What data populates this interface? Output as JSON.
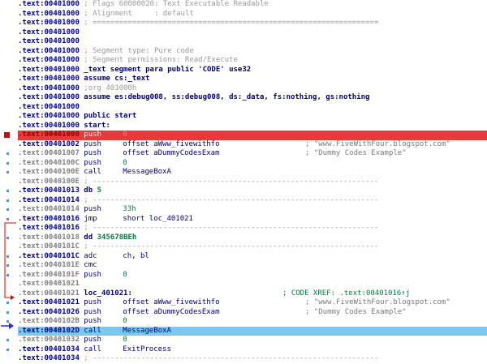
{
  "listing": {
    "lines": [
      {
        "addr": ".text:00401000",
        "text": " ; Flags 60000020: Text Executable Readable"
      },
      {
        "addr": ".text:00401000",
        "text": " ; Alignment     : default"
      },
      {
        "addr": ".text:00401000",
        "text": " ; ================================================================="
      },
      {
        "addr": ".text:00401000",
        "text": ""
      },
      {
        "addr": ".text:00401000",
        "text": ""
      },
      {
        "addr": ".text:00401000",
        "text": " ; Segment type: Pure code"
      },
      {
        "addr": ".text:00401000",
        "text": " ; Segment permissions: Read/Execute"
      },
      {
        "addr": ".text:00401000",
        "text": " _text segment para public 'CODE' use32"
      },
      {
        "addr": ".text:00401000",
        "text": " assume cs:_text"
      },
      {
        "addr": ".text:00401000",
        "text": " ;org 401000h"
      },
      {
        "addr": ".text:00401000",
        "text": " assume es:debug008, ss:debug008, ds:_data, fs:nothing, gs:nothing"
      },
      {
        "addr": ".text:00401000",
        "text": ""
      },
      {
        "addr": ".text:00401000",
        "text": " public start"
      },
      {
        "addr": ".text:00401000",
        "text": " start:"
      },
      {
        "addr": ".text:00401000",
        "mnemonic": "push",
        "operand": "0"
      },
      {
        "addr": ".text:00401002",
        "mnemonic": "push",
        "operand": "offset aWww_fivewithfo",
        "comment": "; \"www.FiveWithFour.blogspot.com\""
      },
      {
        "addr": ".text:00401007",
        "mnemonic": "push",
        "operand": "offset aDummyCodesExam",
        "comment": "; \"Dummy Codes Example\""
      },
      {
        "addr": ".text:0040100C",
        "mnemonic": "push",
        "operand": "0"
      },
      {
        "addr": ".text:0040100E",
        "mnemonic": "call",
        "operand": "MessageBoxA"
      },
      {
        "addr": ".text:0040100E",
        "text": " ; -----------------------------------------------------------------"
      },
      {
        "addr": ".text:00401013",
        "text": " db 5"
      },
      {
        "addr": ".text:00401014",
        "text": " ; -----------------------------------------------------------------"
      },
      {
        "addr": ".text:00401014",
        "mnemonic": "push",
        "operand": "33h"
      },
      {
        "addr": ".text:00401016",
        "mnemonic": "jmp",
        "operand": "short loc_401021"
      },
      {
        "addr": ".text:00401016",
        "text": " ; -----------------------------------------------------------------"
      },
      {
        "addr": ".text:00401018",
        "text": " dd 345678BEh"
      },
      {
        "addr": ".text:0040101C",
        "text": " ; -----------------------------------------------------------------"
      },
      {
        "addr": ".text:0040101C",
        "mnemonic": "adc",
        "operand": "ch, bl"
      },
      {
        "addr": ".text:0040101E",
        "mnemonic": "cmc",
        "operand": ""
      },
      {
        "addr": ".text:0040101F",
        "mnemonic": "push",
        "operand": "0"
      },
      {
        "addr": ".text:00401021",
        "text": ""
      },
      {
        "addr": ".text:00401021",
        "text": " loc_401021:",
        "comment": "; CODE XREF: .text:00401016↑j"
      },
      {
        "addr": ".text:00401021",
        "mnemonic": "push",
        "operand": "offset aWww_fivewithfo",
        "comment": "; \"www.FiveWithFour.blogspot.com\""
      },
      {
        "addr": ".text:00401026",
        "mnemonic": "push",
        "operand": "offset aDummyCodesExam",
        "comment": "; \"Dummy Codes Example\""
      },
      {
        "addr": ".text:0040102B",
        "mnemonic": "push",
        "operand": "0"
      },
      {
        "addr": ".text:0040102D",
        "mnemonic": "call",
        "operand": "MessageBoxA"
      },
      {
        "addr": ".text:00401032",
        "mnemonic": "push",
        "operand": "0"
      },
      {
        "addr": ".text:00401034",
        "mnemonic": "call",
        "operand": "ExitProcess"
      },
      {
        "addr": ".text:00401034",
        "text": " ; -----------------------------------------------------------------"
      }
    ]
  },
  "colors": {
    "breakpoint_line": "#e83a3a",
    "current_line": "#78c8f0",
    "address": "#0000a0",
    "number": "#008040",
    "gutter_arrow": "#e00000",
    "current_arrow": "#2a2ad0"
  }
}
